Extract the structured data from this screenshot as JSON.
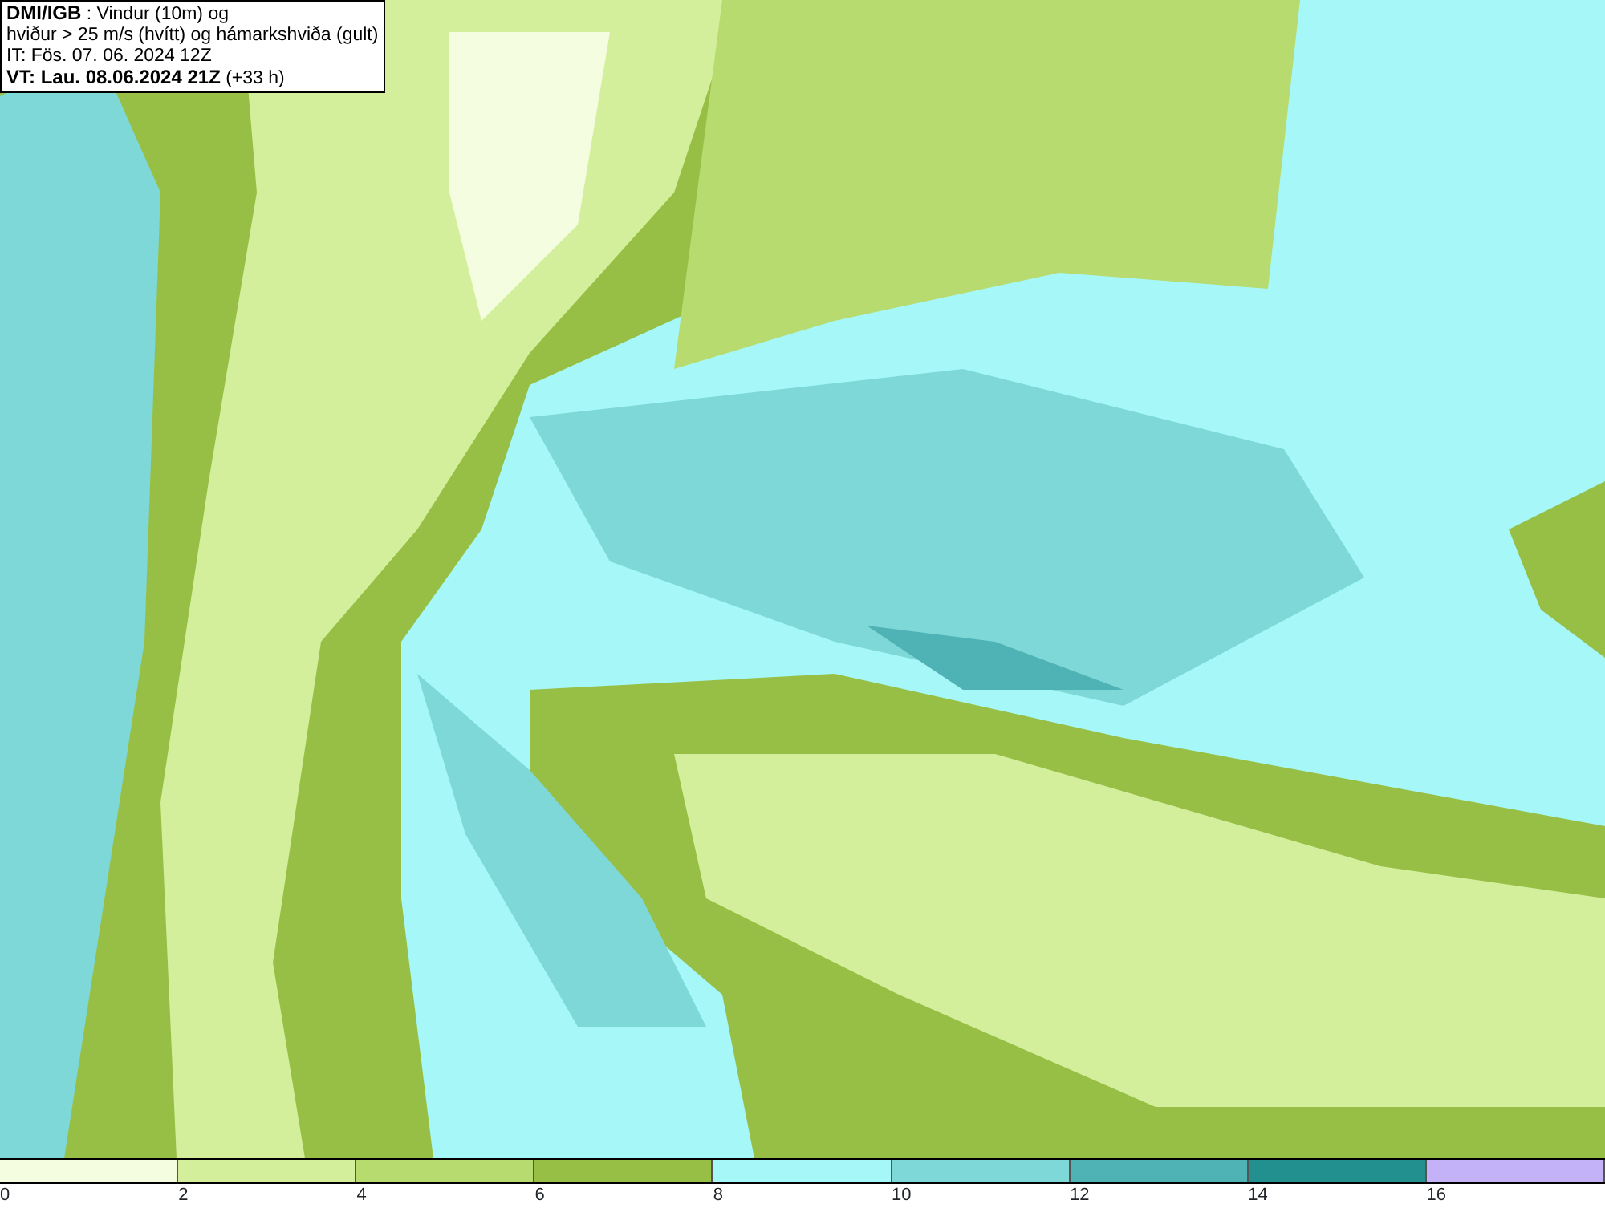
{
  "title_box": {
    "lines": [
      "**DMI/IGB** : Vindur (10m) og",
      "hviður > 25 m/s (hvítt) og hámarkshviða (gult)",
      "IT: Fös. 07. 06. 2024 12Z",
      "**VT: Lau. 08.06.2024 21Z** (+33 h)"
    ]
  },
  "legend": {
    "segments": [
      {
        "color": "#f5fde0"
      },
      {
        "color": "#d4ef9c"
      },
      {
        "color": "#b7db6e"
      },
      {
        "color": "#98bf45"
      },
      {
        "color": "#a6f8f8"
      },
      {
        "color": "#7fd8d8"
      },
      {
        "color": "#4fb2b4"
      },
      {
        "color": "#22908f"
      },
      {
        "color": "#c3b2f7"
      }
    ],
    "ticks": [
      "0",
      "2",
      "4",
      "6",
      "8",
      "10",
      "12",
      "14",
      "16"
    ]
  }
}
